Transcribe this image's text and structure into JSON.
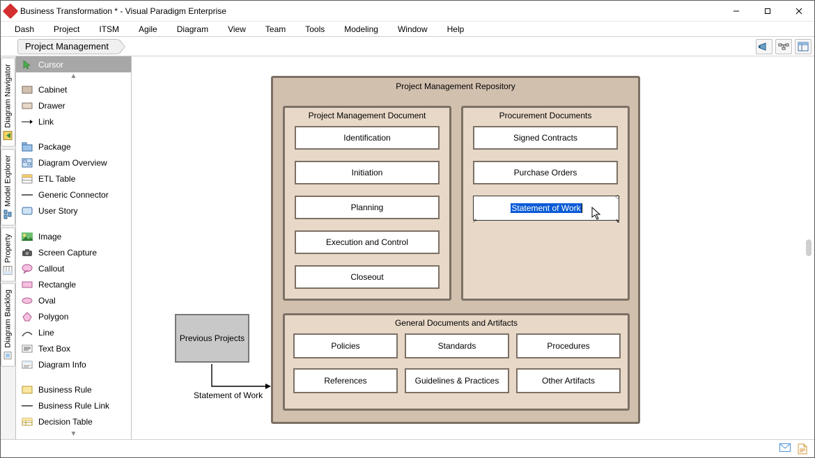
{
  "window": {
    "title": "Business Transformation * - Visual Paradigm Enterprise"
  },
  "menu": {
    "items": [
      "Dash",
      "Project",
      "ITSM",
      "Agile",
      "Diagram",
      "View",
      "Team",
      "Tools",
      "Modeling",
      "Window",
      "Help"
    ]
  },
  "breadcrumb": {
    "current": "Project Management"
  },
  "sidetabs": {
    "items": [
      "Diagram Navigator",
      "Model Explorer",
      "Property",
      "Diagram Backlog"
    ]
  },
  "palette": {
    "items": [
      {
        "label": "Cursor",
        "icon": "cursor-icon",
        "selected": true
      },
      {
        "label": "Cabinet",
        "icon": "cabinet-icon"
      },
      {
        "label": "Drawer",
        "icon": "drawer-icon"
      },
      {
        "label": "Link",
        "icon": "link-icon"
      },
      {
        "label": "Package",
        "icon": "package-icon"
      },
      {
        "label": "Diagram Overview",
        "icon": "overview-icon"
      },
      {
        "label": "ETL Table",
        "icon": "etl-icon"
      },
      {
        "label": "Generic Connector",
        "icon": "connector-icon"
      },
      {
        "label": "User Story",
        "icon": "userstory-icon"
      },
      {
        "label": "Image",
        "icon": "image-icon"
      },
      {
        "label": "Screen Capture",
        "icon": "capture-icon"
      },
      {
        "label": "Callout",
        "icon": "callout-icon"
      },
      {
        "label": "Rectangle",
        "icon": "rectangle-icon"
      },
      {
        "label": "Oval",
        "icon": "oval-icon"
      },
      {
        "label": "Polygon",
        "icon": "polygon-icon"
      },
      {
        "label": "Line",
        "icon": "line-icon"
      },
      {
        "label": "Text Box",
        "icon": "textbox-icon"
      },
      {
        "label": "Diagram Info",
        "icon": "diagraminfo-icon"
      },
      {
        "label": "Business Rule",
        "icon": "bizrule-icon"
      },
      {
        "label": "Business Rule Link",
        "icon": "bizrulelink-icon"
      },
      {
        "label": "Decision Table",
        "icon": "decisiontable-icon"
      }
    ]
  },
  "diagram": {
    "repository_title": "Project Management Repository",
    "pm_doc_title": "Project Management Document",
    "pm_docs": [
      "Identification",
      "Initiation",
      "Planning",
      "Execution and Control",
      "Closeout"
    ],
    "proc_title": "Procurement Documents",
    "proc_docs": [
      "Signed Contracts",
      "Purchase Orders"
    ],
    "proc_editing": "Statement of Work",
    "general_title": "General Documents and Artifacts",
    "general_docs": [
      "Policies",
      "Standards",
      "Procedures",
      "References",
      "Guidelines & Practices",
      "Other Artifacts"
    ],
    "previous_projects": "Previous Projects",
    "edge_label": "Statement of Work"
  }
}
